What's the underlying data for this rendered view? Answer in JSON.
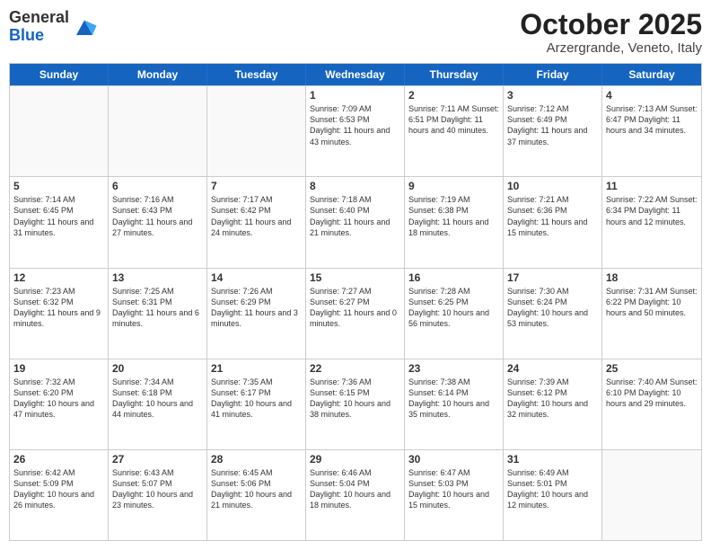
{
  "header": {
    "logo_line1": "General",
    "logo_line2": "Blue",
    "month_title": "October 2025",
    "location": "Arzergrande, Veneto, Italy"
  },
  "days_of_week": [
    "Sunday",
    "Monday",
    "Tuesday",
    "Wednesday",
    "Thursday",
    "Friday",
    "Saturday"
  ],
  "weeks": [
    [
      {
        "day": "",
        "info": ""
      },
      {
        "day": "",
        "info": ""
      },
      {
        "day": "",
        "info": ""
      },
      {
        "day": "1",
        "info": "Sunrise: 7:09 AM\nSunset: 6:53 PM\nDaylight: 11 hours and 43 minutes."
      },
      {
        "day": "2",
        "info": "Sunrise: 7:11 AM\nSunset: 6:51 PM\nDaylight: 11 hours and 40 minutes."
      },
      {
        "day": "3",
        "info": "Sunrise: 7:12 AM\nSunset: 6:49 PM\nDaylight: 11 hours and 37 minutes."
      },
      {
        "day": "4",
        "info": "Sunrise: 7:13 AM\nSunset: 6:47 PM\nDaylight: 11 hours and 34 minutes."
      }
    ],
    [
      {
        "day": "5",
        "info": "Sunrise: 7:14 AM\nSunset: 6:45 PM\nDaylight: 11 hours and 31 minutes."
      },
      {
        "day": "6",
        "info": "Sunrise: 7:16 AM\nSunset: 6:43 PM\nDaylight: 11 hours and 27 minutes."
      },
      {
        "day": "7",
        "info": "Sunrise: 7:17 AM\nSunset: 6:42 PM\nDaylight: 11 hours and 24 minutes."
      },
      {
        "day": "8",
        "info": "Sunrise: 7:18 AM\nSunset: 6:40 PM\nDaylight: 11 hours and 21 minutes."
      },
      {
        "day": "9",
        "info": "Sunrise: 7:19 AM\nSunset: 6:38 PM\nDaylight: 11 hours and 18 minutes."
      },
      {
        "day": "10",
        "info": "Sunrise: 7:21 AM\nSunset: 6:36 PM\nDaylight: 11 hours and 15 minutes."
      },
      {
        "day": "11",
        "info": "Sunrise: 7:22 AM\nSunset: 6:34 PM\nDaylight: 11 hours and 12 minutes."
      }
    ],
    [
      {
        "day": "12",
        "info": "Sunrise: 7:23 AM\nSunset: 6:32 PM\nDaylight: 11 hours and 9 minutes."
      },
      {
        "day": "13",
        "info": "Sunrise: 7:25 AM\nSunset: 6:31 PM\nDaylight: 11 hours and 6 minutes."
      },
      {
        "day": "14",
        "info": "Sunrise: 7:26 AM\nSunset: 6:29 PM\nDaylight: 11 hours and 3 minutes."
      },
      {
        "day": "15",
        "info": "Sunrise: 7:27 AM\nSunset: 6:27 PM\nDaylight: 11 hours and 0 minutes."
      },
      {
        "day": "16",
        "info": "Sunrise: 7:28 AM\nSunset: 6:25 PM\nDaylight: 10 hours and 56 minutes."
      },
      {
        "day": "17",
        "info": "Sunrise: 7:30 AM\nSunset: 6:24 PM\nDaylight: 10 hours and 53 minutes."
      },
      {
        "day": "18",
        "info": "Sunrise: 7:31 AM\nSunset: 6:22 PM\nDaylight: 10 hours and 50 minutes."
      }
    ],
    [
      {
        "day": "19",
        "info": "Sunrise: 7:32 AM\nSunset: 6:20 PM\nDaylight: 10 hours and 47 minutes."
      },
      {
        "day": "20",
        "info": "Sunrise: 7:34 AM\nSunset: 6:18 PM\nDaylight: 10 hours and 44 minutes."
      },
      {
        "day": "21",
        "info": "Sunrise: 7:35 AM\nSunset: 6:17 PM\nDaylight: 10 hours and 41 minutes."
      },
      {
        "day": "22",
        "info": "Sunrise: 7:36 AM\nSunset: 6:15 PM\nDaylight: 10 hours and 38 minutes."
      },
      {
        "day": "23",
        "info": "Sunrise: 7:38 AM\nSunset: 6:14 PM\nDaylight: 10 hours and 35 minutes."
      },
      {
        "day": "24",
        "info": "Sunrise: 7:39 AM\nSunset: 6:12 PM\nDaylight: 10 hours and 32 minutes."
      },
      {
        "day": "25",
        "info": "Sunrise: 7:40 AM\nSunset: 6:10 PM\nDaylight: 10 hours and 29 minutes."
      }
    ],
    [
      {
        "day": "26",
        "info": "Sunrise: 6:42 AM\nSunset: 5:09 PM\nDaylight: 10 hours and 26 minutes."
      },
      {
        "day": "27",
        "info": "Sunrise: 6:43 AM\nSunset: 5:07 PM\nDaylight: 10 hours and 23 minutes."
      },
      {
        "day": "28",
        "info": "Sunrise: 6:45 AM\nSunset: 5:06 PM\nDaylight: 10 hours and 21 minutes."
      },
      {
        "day": "29",
        "info": "Sunrise: 6:46 AM\nSunset: 5:04 PM\nDaylight: 10 hours and 18 minutes."
      },
      {
        "day": "30",
        "info": "Sunrise: 6:47 AM\nSunset: 5:03 PM\nDaylight: 10 hours and 15 minutes."
      },
      {
        "day": "31",
        "info": "Sunrise: 6:49 AM\nSunset: 5:01 PM\nDaylight: 10 hours and 12 minutes."
      },
      {
        "day": "",
        "info": ""
      }
    ]
  ]
}
